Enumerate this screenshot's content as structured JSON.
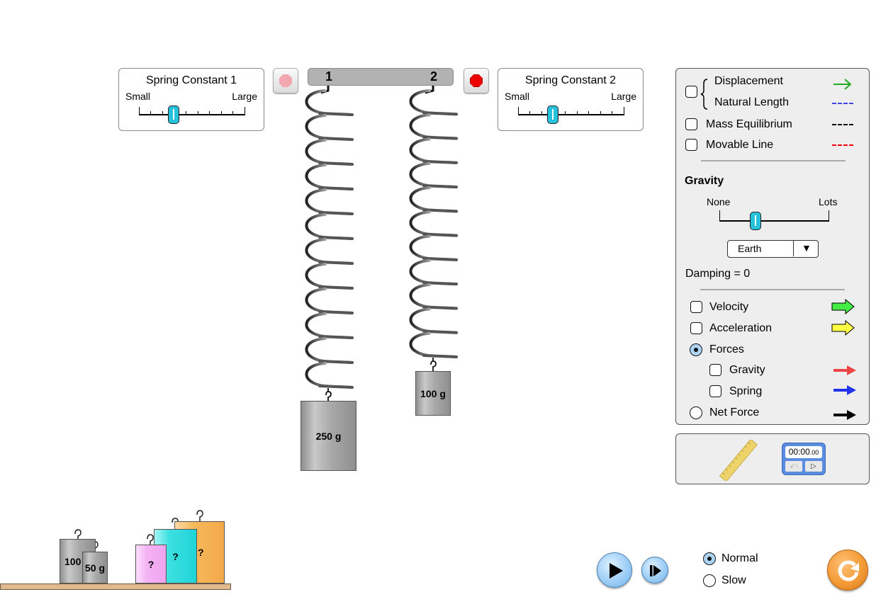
{
  "spring_constant_1": {
    "title": "Spring Constant 1",
    "min_label": "Small",
    "max_label": "Large",
    "value_fraction": 0.33
  },
  "spring_constant_2": {
    "title": "Spring Constant 2",
    "min_label": "Small",
    "max_label": "Large",
    "value_fraction": 0.33
  },
  "stop_buttons": {
    "left": {
      "icon": "stop-sign-icon",
      "enabled": false,
      "color": "#f0a0a8"
    },
    "right": {
      "icon": "stop-sign-icon",
      "enabled": true,
      "color": "#ee0000"
    }
  },
  "ceiling_bar": {
    "label_1": "1",
    "label_2": "2"
  },
  "hanging_masses": [
    {
      "label": "250 g",
      "spring": "1"
    },
    {
      "label": "100 g",
      "spring": "2"
    }
  ],
  "shelf_masses": [
    {
      "label": "100",
      "color": "#a8a8a8"
    },
    {
      "label": "50 g",
      "color": "#a8a8a8"
    },
    {
      "label": "?",
      "color": "#f0a8f0"
    },
    {
      "label": "?",
      "color": "#28dada"
    },
    {
      "label": "?",
      "color": "#f6b85a"
    }
  ],
  "options": {
    "displacement": {
      "label": "Displacement",
      "color": "#22aa22",
      "icon": "arrow-right-icon"
    },
    "natural_length": {
      "label": "Natural Length",
      "color": "#4444ee",
      "checked": false
    },
    "mass_equilibrium": {
      "label": "Mass Equilibrium",
      "color": "#000000",
      "checked": false
    },
    "movable_line": {
      "label": "Movable Line",
      "color": "#ee0000",
      "checked": false
    }
  },
  "gravity": {
    "title": "Gravity",
    "min_label": "None",
    "max_label": "Lots",
    "value_fraction": 0.33,
    "selected_planet": "Earth",
    "dropdown_icon": "triangle-down-icon"
  },
  "damping": {
    "label": "Damping = 0"
  },
  "vectors": {
    "velocity": {
      "label": "Velocity",
      "checked": false,
      "color": "#44ee44"
    },
    "acceleration": {
      "label": "Acceleration",
      "checked": false,
      "color": "#ffff44"
    },
    "forces": {
      "label": "Forces",
      "selected": true
    },
    "gravity_force": {
      "label": "Gravity",
      "checked": false,
      "color": "#ee4444"
    },
    "spring_force": {
      "label": "Spring",
      "checked": false,
      "color": "#2233ee"
    },
    "net_force": {
      "label": "Net Force",
      "selected": false,
      "color": "#000000"
    }
  },
  "tools": {
    "ruler": "ruler-icon",
    "stopwatch": {
      "time": "00:00",
      "fraction": ".00"
    }
  },
  "playback": {
    "play": "play-icon",
    "step": "step-icon",
    "speed_normal": "Normal",
    "speed_slow": "Slow",
    "speed_selected": "Normal",
    "reset": "reset-icon"
  }
}
